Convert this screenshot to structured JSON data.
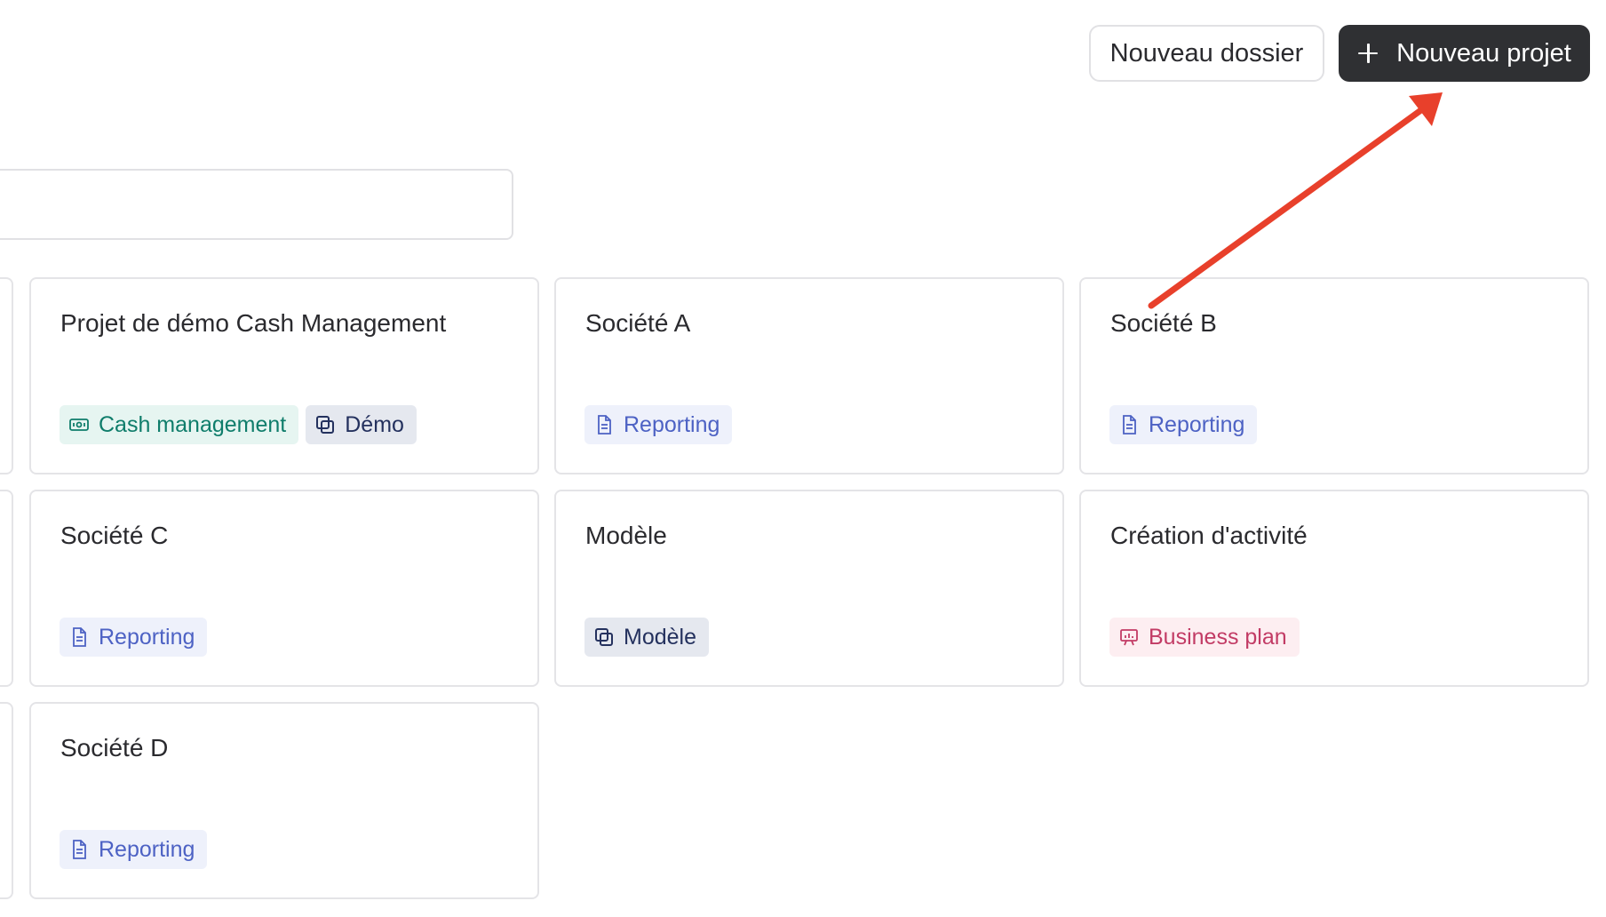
{
  "header": {
    "new_folder_label": "Nouveau dossier",
    "new_project_label": "Nouveau projet"
  },
  "projects": [
    {
      "title": "Projet de démo Cash Management",
      "tags": [
        {
          "label": "Cash management",
          "kind": "cash",
          "icon": "banknote-icon"
        },
        {
          "label": "Démo",
          "kind": "demo",
          "icon": "copy-icon"
        }
      ]
    },
    {
      "title": "Société A",
      "tags": [
        {
          "label": "Reporting",
          "kind": "reporting",
          "icon": "document-icon"
        }
      ]
    },
    {
      "title": "Société B",
      "tags": [
        {
          "label": "Reporting",
          "kind": "reporting",
          "icon": "document-icon"
        }
      ]
    },
    {
      "title": "Société C",
      "tags": [
        {
          "label": "Reporting",
          "kind": "reporting",
          "icon": "document-icon"
        }
      ]
    },
    {
      "title": "Modèle",
      "tags": [
        {
          "label": "Modèle",
          "kind": "model",
          "icon": "copy-icon"
        }
      ]
    },
    {
      "title": "Création d'activité",
      "tags": [
        {
          "label": "Business plan",
          "kind": "business",
          "icon": "presentation-icon"
        }
      ]
    },
    {
      "title": "Société D",
      "tags": [
        {
          "label": "Reporting",
          "kind": "reporting",
          "icon": "document-icon"
        }
      ]
    }
  ],
  "colors": {
    "primary_button": "#2f3033",
    "annotation_arrow": "#e8402b",
    "reporting": "#4d62c4",
    "cash": "#0f7d6b",
    "demo": "#24315e",
    "business": "#c23b65"
  }
}
